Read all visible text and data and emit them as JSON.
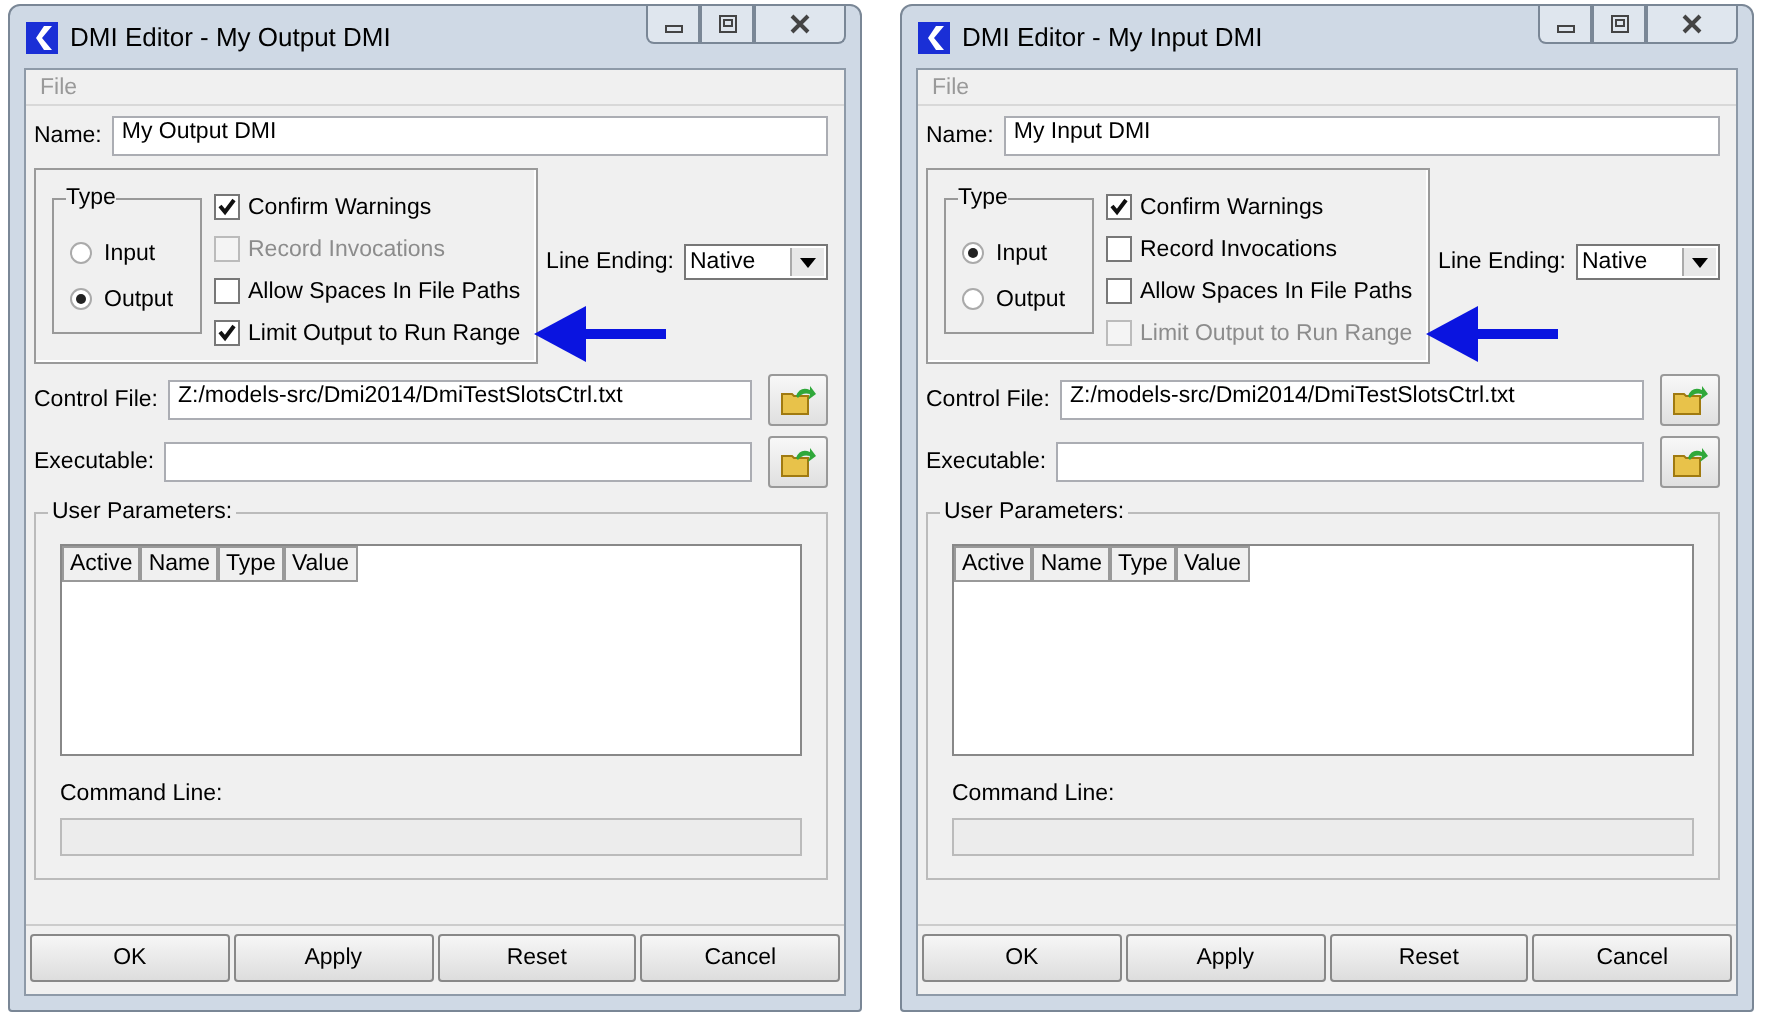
{
  "windows": [
    {
      "title": "DMI Editor - My Output DMI",
      "menu": [
        {
          "label": "File",
          "disabled": true
        }
      ],
      "name_label": "Name:",
      "name_value": "My Output DMI",
      "type_group": {
        "label": "Type",
        "options": [
          {
            "label": "Input",
            "selected": false
          },
          {
            "label": "Output",
            "selected": true
          }
        ]
      },
      "checkboxes": [
        {
          "label": "Confirm Warnings",
          "checked": true,
          "disabled": false
        },
        {
          "label": "Record Invocations",
          "checked": false,
          "disabled": true
        },
        {
          "label": "Allow Spaces In File Paths",
          "checked": false,
          "disabled": false
        },
        {
          "label": "Limit Output to Run Range",
          "checked": true,
          "disabled": false
        }
      ],
      "line_ending_label": "Line Ending:",
      "line_ending_value": "Native",
      "control_file_label": "Control File:",
      "control_file_value": "Z:/models-src/Dmi2014/DmiTestSlotsCtrl.txt",
      "executable_label": "Executable:",
      "user_parameters_label": "User Parameters:",
      "columns": [
        "Active",
        "Name",
        "Type",
        "Value"
      ],
      "command_line_label": "Command Line:",
      "buttons": [
        "OK",
        "Apply",
        "Reset",
        "Cancel"
      ]
    },
    {
      "title": "DMI Editor - My Input DMI",
      "menu": [
        {
          "label": "File",
          "disabled": true
        }
      ],
      "name_label": "Name:",
      "name_value": "My Input DMI",
      "type_group": {
        "label": "Type",
        "options": [
          {
            "label": "Input",
            "selected": true
          },
          {
            "label": "Output",
            "selected": false
          }
        ]
      },
      "checkboxes": [
        {
          "label": "Confirm Warnings",
          "checked": true,
          "disabled": false
        },
        {
          "label": "Record Invocations",
          "checked": false,
          "disabled": false
        },
        {
          "label": "Allow Spaces In File Paths",
          "checked": false,
          "disabled": false
        },
        {
          "label": "Limit Output to Run Range",
          "checked": false,
          "disabled": true
        }
      ],
      "line_ending_label": "Line Ending:",
      "line_ending_value": "Native",
      "control_file_label": "Control File:",
      "control_file_value": "Z:/models-src/Dmi2014/DmiTestSlotsCtrl.txt",
      "executable_label": "Executable:",
      "user_parameters_label": "User Parameters:",
      "columns": [
        "Active",
        "Name",
        "Type",
        "Value"
      ],
      "command_line_label": "Command Line:",
      "buttons": [
        "OK",
        "Apply",
        "Reset",
        "Cancel"
      ]
    }
  ]
}
